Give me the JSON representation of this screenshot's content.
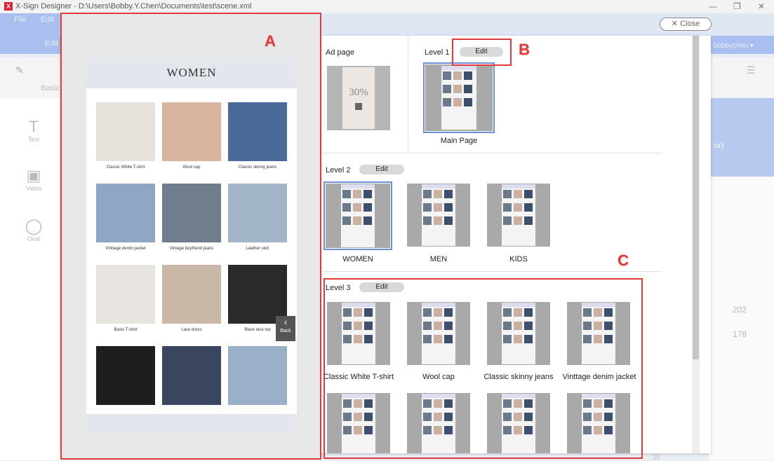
{
  "window": {
    "title": "X-Sign Designer - D:\\Users\\Bobby.Y.Chen\\Documents\\test\\scene.xml",
    "minimize": "—",
    "restore": "❐",
    "close": "✕"
  },
  "background_app": {
    "menu": [
      "File",
      "Edit"
    ],
    "edit_short": "Edit",
    "user": "bobbychen ▾",
    "basic_tab": "Basic",
    "tools": [
      {
        "label": "Text",
        "glyph": "T"
      },
      {
        "label": "Video",
        "glyph": "▣"
      },
      {
        "label": "Oval",
        "glyph": "◯"
      }
    ],
    "right_text": "or)",
    "spin_values": [
      "202",
      "178"
    ],
    "bottom_num": "25"
  },
  "dialog": {
    "close_label": "✕  Close",
    "ad_page_label": "Ad page",
    "ad_thumb_text": "30%",
    "level1": {
      "label": "Level 1",
      "edit": "Edit",
      "pages": [
        {
          "caption": "Main Page"
        }
      ]
    },
    "level2": {
      "label": "Level 2",
      "edit": "Edit",
      "pages": [
        {
          "caption": "WOMEN"
        },
        {
          "caption": "MEN"
        },
        {
          "caption": "KIDS"
        }
      ]
    },
    "level3": {
      "label": "Level 3",
      "edit": "Edit",
      "pages": [
        {
          "caption": "Classic White T-shirt"
        },
        {
          "caption": "Wool cap"
        },
        {
          "caption": "Classic skinny jeans"
        },
        {
          "caption": "Vinttage denim jacket"
        },
        {
          "caption": ""
        },
        {
          "caption": ""
        },
        {
          "caption": ""
        },
        {
          "caption": ""
        }
      ]
    }
  },
  "preview": {
    "header": "WOMEN",
    "items": [
      {
        "caption": "Classic White T-shirt",
        "color": "#e8e2dc"
      },
      {
        "caption": "Wool cap",
        "color": "#d9b5a0"
      },
      {
        "caption": "Classic skinny jeans",
        "color": "#4a6b9a"
      },
      {
        "caption": "Vinttage denim jacket",
        "color": "#8fa7c4"
      },
      {
        "caption": "Vintage boyfriend jeans",
        "color": "#6f7d8c"
      },
      {
        "caption": "Leather skirt",
        "color": "#a3b5c9"
      },
      {
        "caption": "Basic T-shirt",
        "color": "#e8e4df"
      },
      {
        "caption": "Lace dress",
        "color": "#c9b7a8"
      },
      {
        "caption": "Black lace top",
        "color": "#2a2a2a"
      },
      {
        "caption": "",
        "color": "#1e1e1e"
      },
      {
        "caption": "",
        "color": "#3a4660"
      },
      {
        "caption": "",
        "color": "#9ab0c8"
      }
    ],
    "back_label": "Back"
  },
  "callouts": {
    "a": "A",
    "b": "B",
    "c": "C"
  },
  "colors": {
    "annotation_red": "#e03a3a",
    "selection_blue": "#6f8ed8",
    "thumb_gray": "#a9a9a9"
  }
}
